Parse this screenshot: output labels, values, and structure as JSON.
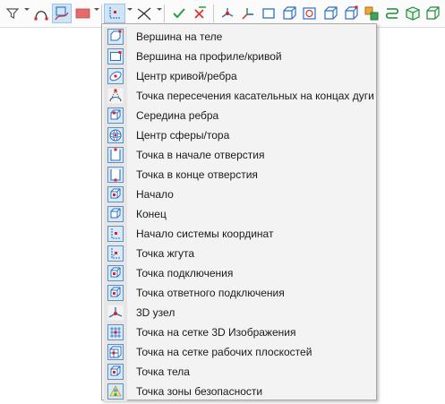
{
  "menu": {
    "items": [
      {
        "label": "Вершина на теле",
        "icon": "vertex-on-body-icon"
      },
      {
        "label": "Вершина на профиле/кривой",
        "icon": "vertex-on-profile-icon"
      },
      {
        "label": "Центр кривой/ребра",
        "icon": "curve-center-icon"
      },
      {
        "label": "Точка пересечения касательных на концах дуги",
        "icon": "tangent-intersection-icon"
      },
      {
        "label": "Середина ребра",
        "icon": "edge-midpoint-icon"
      },
      {
        "label": "Центр сферы/тора",
        "icon": "sphere-center-icon"
      },
      {
        "label": "Точка в начале отверстия",
        "icon": "hole-start-icon"
      },
      {
        "label": "Точка в конце отверстия",
        "icon": "hole-end-icon"
      },
      {
        "label": "Начало",
        "icon": "start-point-icon"
      },
      {
        "label": "Конец",
        "icon": "end-point-icon"
      },
      {
        "label": "Начало системы координат",
        "icon": "coordinate-origin-icon"
      },
      {
        "label": "Точка жгута",
        "icon": "harness-point-icon"
      },
      {
        "label": "Точка подключения",
        "icon": "connection-point-icon"
      },
      {
        "label": "Точка ответного подключения",
        "icon": "mating-connection-icon"
      },
      {
        "label": "3D узел",
        "icon": "3d-node-icon"
      },
      {
        "label": "Точка на сетке 3D Изображения",
        "icon": "3d-image-grid-point-icon"
      },
      {
        "label": "Точка на сетке рабочих плоскостей",
        "icon": "workplane-grid-point-icon"
      },
      {
        "label": "Точка тела",
        "icon": "body-point-icon"
      },
      {
        "label": "Точка зоны безопасности",
        "icon": "safety-zone-point-icon"
      }
    ]
  }
}
